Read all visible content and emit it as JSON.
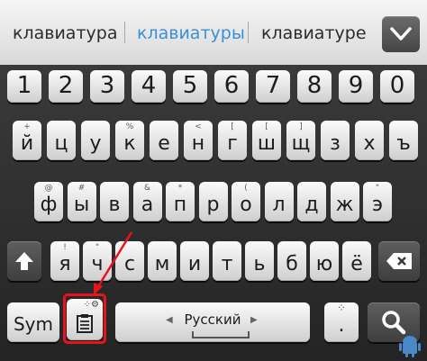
{
  "suggestions": [
    "клавиатура",
    "клавиатуры",
    "клавиатуре"
  ],
  "rows": {
    "numbers": [
      "1",
      "2",
      "3",
      "4",
      "5",
      "6",
      "7",
      "8",
      "9",
      "0"
    ],
    "row1": [
      {
        "main": "й",
        "alt": "+"
      },
      {
        "main": "ц",
        "alt": ""
      },
      {
        "main": "у",
        "alt": ""
      },
      {
        "main": "к",
        "alt": "%"
      },
      {
        "main": "е",
        "alt": ""
      },
      {
        "main": "н",
        "alt": "<"
      },
      {
        "main": "г",
        "alt": "["
      },
      {
        "main": "ш",
        "alt": "["
      },
      {
        "main": "щ",
        "alt": "]"
      },
      {
        "main": "з",
        "alt": ""
      },
      {
        "main": "х",
        "alt": ""
      },
      {
        "main": "ъ",
        "alt": ""
      }
    ],
    "row2": [
      {
        "main": "ф",
        "alt": "@"
      },
      {
        "main": "ы",
        "alt": "#"
      },
      {
        "main": "в",
        "alt": ""
      },
      {
        "main": "а",
        "alt": "&"
      },
      {
        "main": "п",
        "alt": "*"
      },
      {
        "main": "р",
        "alt": ""
      },
      {
        "main": "о",
        "alt": "("
      },
      {
        "main": "л",
        "alt": ""
      },
      {
        "main": "д",
        "alt": ""
      },
      {
        "main": "ж",
        "alt": ""
      },
      {
        "main": "э",
        "alt": "\""
      }
    ],
    "row3": [
      {
        "main": "я",
        "alt": "!"
      },
      {
        "main": "ч",
        "alt": "\""
      },
      {
        "main": "с",
        "alt": ""
      },
      {
        "main": "м",
        "alt": ""
      },
      {
        "main": "и",
        "alt": ""
      },
      {
        "main": "т",
        "alt": ""
      },
      {
        "main": "ь",
        "alt": ""
      },
      {
        "main": "б",
        "alt": ""
      },
      {
        "main": "ю",
        "alt": ""
      },
      {
        "main": "ё",
        "alt": ""
      }
    ]
  },
  "bottom": {
    "sym_label": "Sym",
    "language_label": "Русский",
    "period": "."
  },
  "colors": {
    "accent_suggestion": "#3a8fd6",
    "highlight": "#e8141c"
  },
  "icons": [
    "chevron-down-icon",
    "shift-arrow-icon",
    "backspace-icon",
    "clipboard-icon",
    "search-icon",
    "android-icon"
  ]
}
